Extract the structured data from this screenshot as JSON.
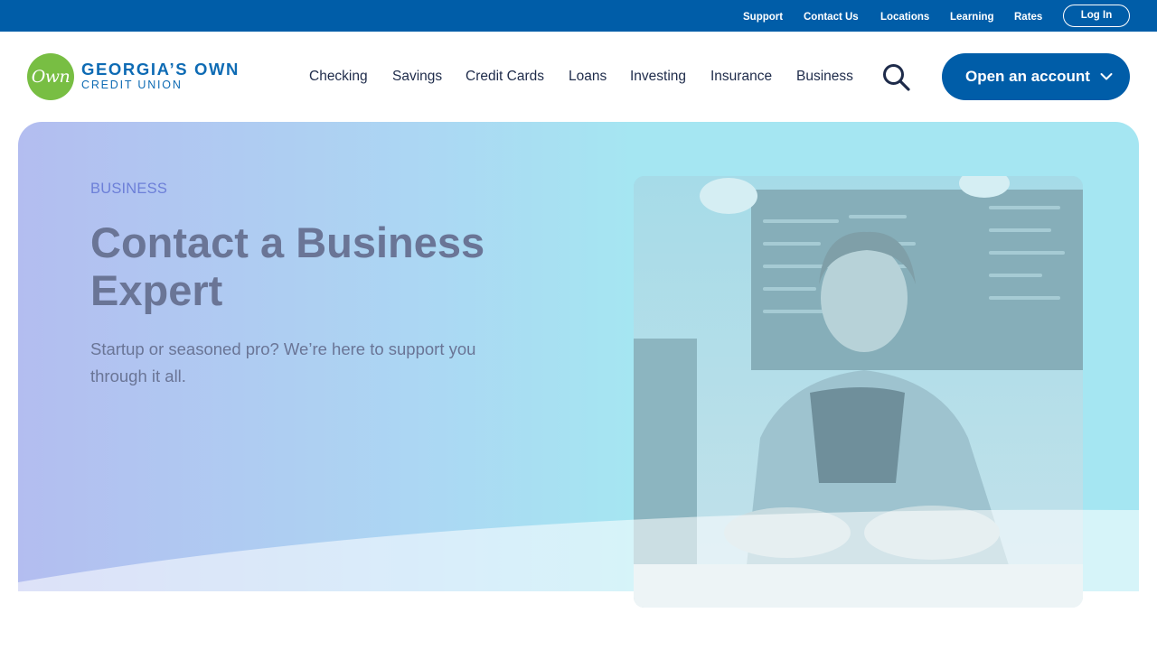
{
  "utility_nav": {
    "links": [
      "Support",
      "Contact Us",
      "Locations",
      "Learning",
      "Rates"
    ],
    "login_label": "Log In"
  },
  "logo": {
    "mark_text": "Own",
    "line1": "GEORGIA’S OWN",
    "line2": "CREDIT UNION"
  },
  "main_nav": {
    "items": [
      "Checking",
      "Savings",
      "Credit Cards",
      "Loans",
      "Investing",
      "Insurance",
      "Business"
    ],
    "search_icon": "search-icon",
    "cta_label": "Open an account",
    "cta_icon": "chevron-down-icon"
  },
  "hero": {
    "eyebrow": "BUSINESS",
    "title": "Contact a Business Expert",
    "subtitle": "Startup or seasoned pro? We’re here to support you through it all."
  },
  "colors": {
    "brand_blue": "#005da8",
    "logo_green": "#78be43",
    "hero_gradient_start": "#b3bdf0",
    "hero_gradient_end": "#a5e6f2",
    "heading_text": "#6a7596",
    "eyebrow_text": "#6c7fd8"
  }
}
